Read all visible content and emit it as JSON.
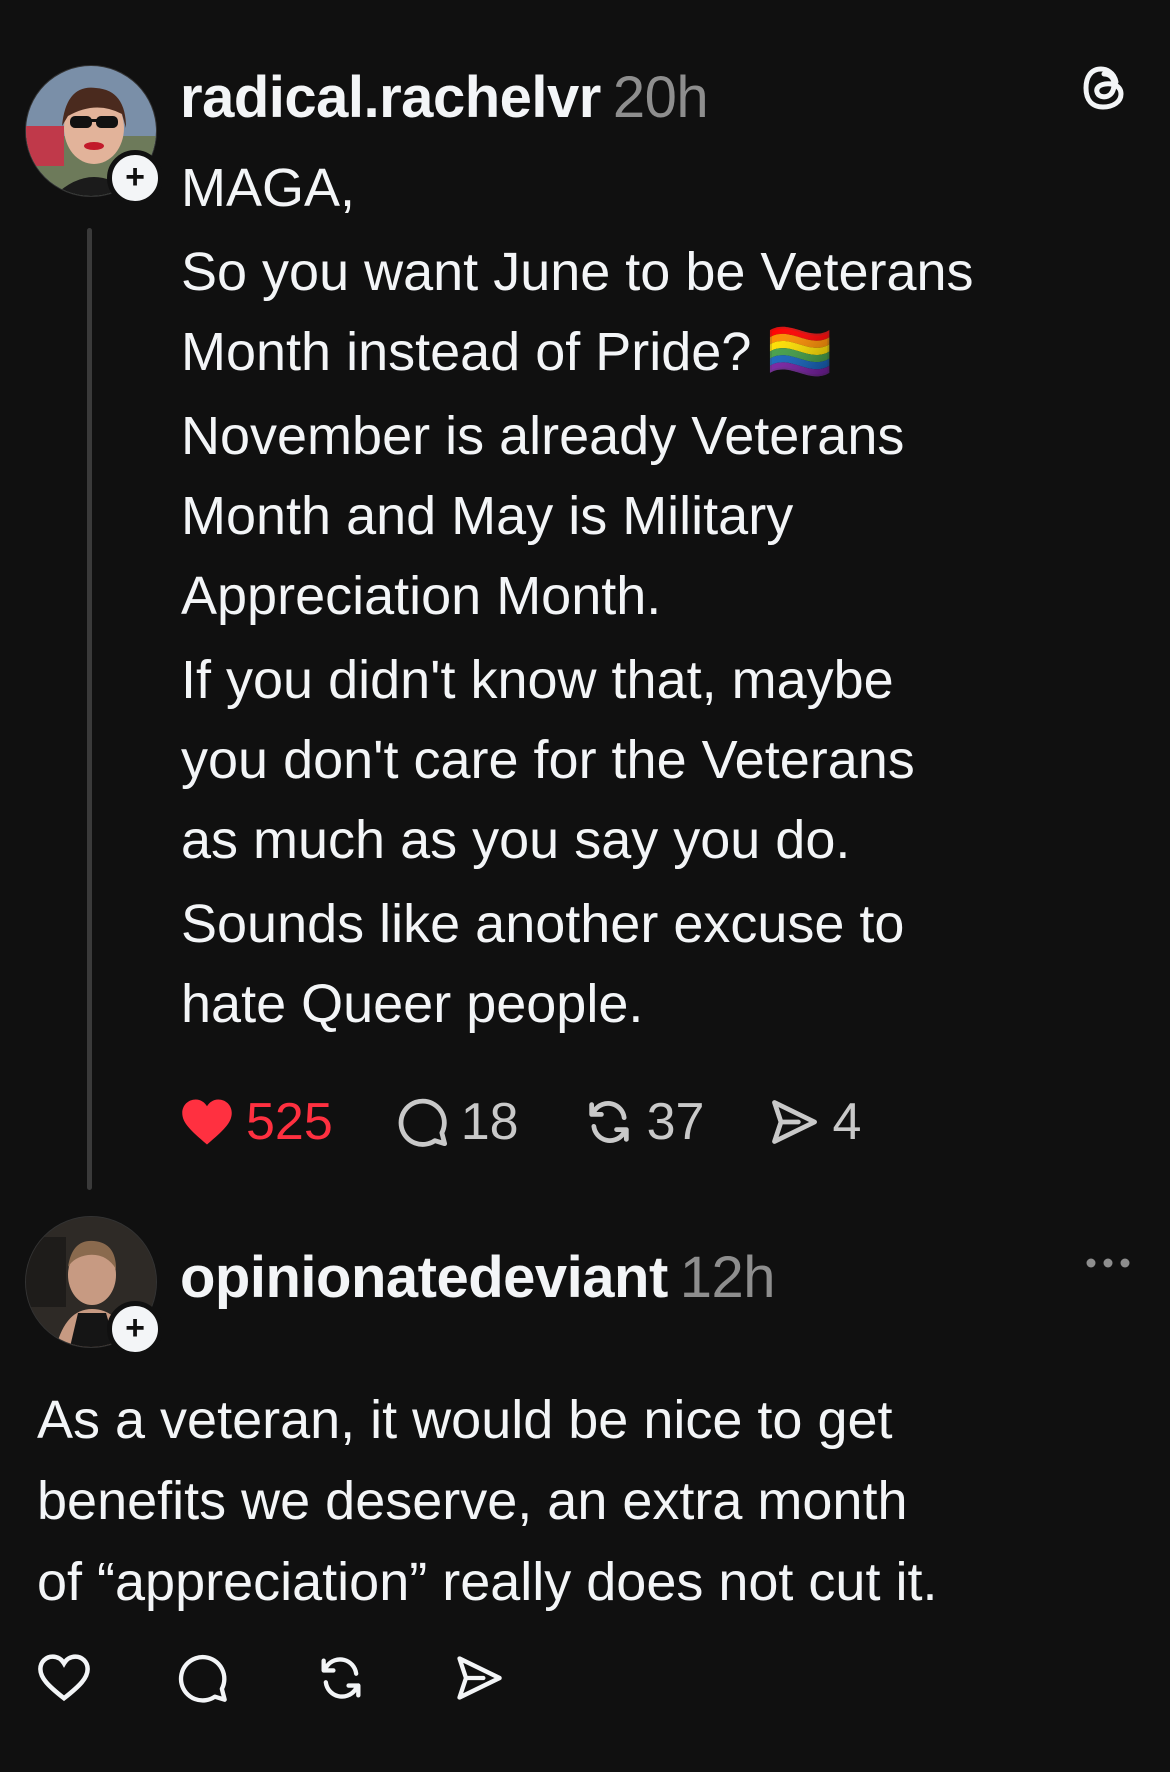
{
  "post": {
    "username": "radical.rachelvr",
    "time": "20h",
    "lines": [
      "MAGA,",
      "So you want June to be Veterans",
      "Month instead of Pride? 🏳️‍🌈",
      "November is already Veterans",
      "Month and May is Military",
      "Appreciation Month.",
      "If you didn't know that, maybe",
      "you don't care for the Veterans",
      "as much as you say you do.",
      "Sounds like another excuse to",
      "hate Queer people."
    ],
    "likes": "525",
    "replies": "18",
    "reposts": "37",
    "shares": "4",
    "liked": true
  },
  "reply": {
    "username": "opinionatedeviant",
    "time": "12h",
    "text": "As a veteran, it would be nice to get\nbenefits we deserve, an extra month\nof “appreciation” really does not cut it."
  },
  "icons": {
    "app": "threads-logo-icon",
    "more": "more-dots-icon",
    "like": "heart-icon",
    "reply": "comment-bubble-icon",
    "repost": "repost-icon",
    "share": "send-icon"
  },
  "colors": {
    "background": "#101010",
    "text": "#f3f5f7",
    "muted": "#8e8e8e",
    "like": "#ff3040"
  }
}
